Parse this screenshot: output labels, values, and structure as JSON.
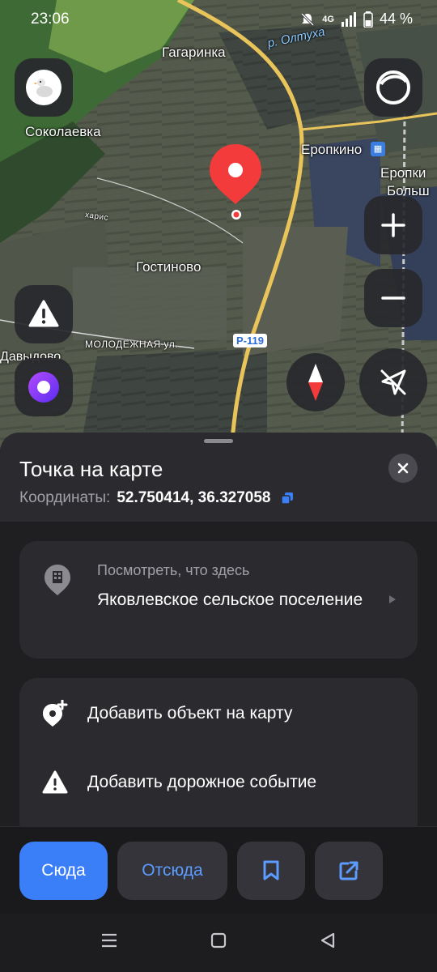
{
  "status_bar": {
    "time": "23:06",
    "network": "4G",
    "battery": "44 %",
    "icons": [
      "mute-icon",
      "wifi-icon",
      "signal-icon",
      "battery-icon"
    ]
  },
  "map": {
    "labels": {
      "gagarinka": "Гагаринка",
      "sokolaevka": "Соколаевка",
      "river": "р. Олтуха",
      "eropkino": "Еропкино",
      "eropkino_right": "Еропки",
      "bolsh": "Больш",
      "gostinovo": "Гостиново",
      "molodezhnaya": "МОЛОДЁЖНАЯ ул.",
      "davydovo": "Давыдово",
      "road": "Р-119",
      "road_small": "харис"
    },
    "colors": {
      "pin": "#f43b3b",
      "road": "#e9c45a"
    }
  },
  "sheet": {
    "title": "Точка на карте",
    "coords_label": "Координаты:",
    "coords_value": "52.750414, 36.327058",
    "place": {
      "subtitle": "Посмотреть, что здесь",
      "name": "Яковлевское сельское поселение"
    },
    "actions": [
      {
        "label": "Добавить объект на карту",
        "icon": "add-place-icon"
      },
      {
        "label": "Добавить дорожное событие",
        "icon": "warning-icon"
      }
    ]
  },
  "action_bar": {
    "here_label": "Сюда",
    "from_label": "Отсюда",
    "accent": "#3a7ef8"
  }
}
